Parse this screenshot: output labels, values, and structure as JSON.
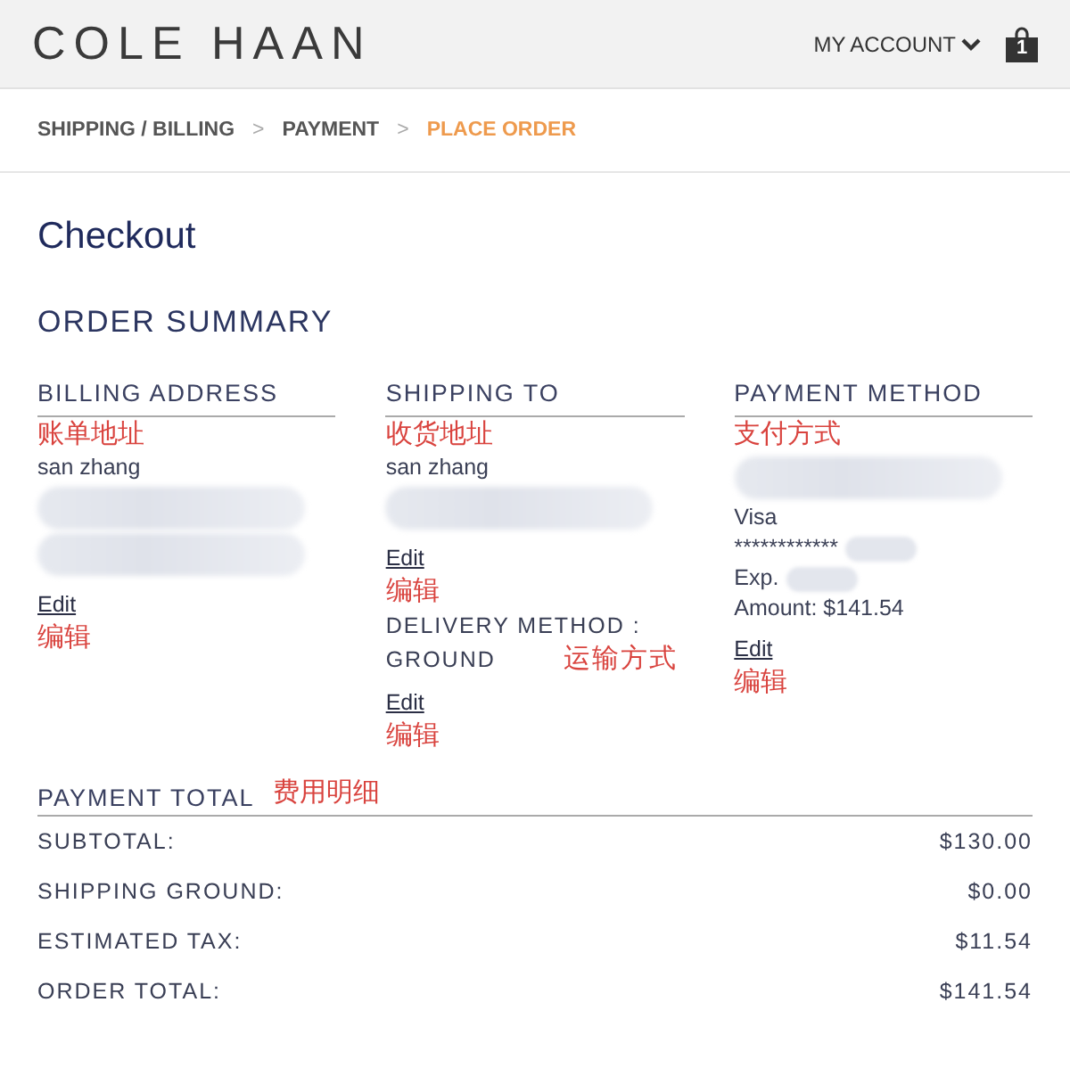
{
  "header": {
    "logo": "COLE HAAN",
    "account": "MY ACCOUNT",
    "cart_count": "1"
  },
  "breadcrumbs": [
    {
      "label": "SHIPPING / BILLING",
      "selected": false
    },
    {
      "label": "PAYMENT",
      "selected": false
    },
    {
      "label": "PLACE ORDER",
      "selected": true
    }
  ],
  "separator": ">",
  "title": "Checkout",
  "order_summary": {
    "heading": "ORDER SUMMARY",
    "columns": [
      {
        "heading": "BILLING ADDRESS",
        "items": [
          {
            "kind": "note",
            "text": "账单地址"
          },
          {
            "kind": "text",
            "text": "san zhang"
          },
          {
            "kind": "blur"
          },
          {
            "kind": "blur"
          },
          {
            "kind": "link",
            "text": "Edit"
          },
          {
            "kind": "note",
            "text": "编辑"
          }
        ]
      },
      {
        "heading": "SHIPPING TO",
        "items": [
          {
            "kind": "note",
            "text": "收货地址"
          },
          {
            "kind": "text",
            "text": "san zhang"
          },
          {
            "kind": "blur"
          },
          {
            "kind": "link",
            "text": "Edit"
          },
          {
            "kind": "note",
            "text": "编辑"
          },
          {
            "kind": "caps",
            "text": "DELIVERY METHOD :"
          },
          {
            "kind": "caps",
            "text": "GROUND",
            "note": "运输方式"
          },
          {
            "kind": "link",
            "text": "Edit"
          },
          {
            "kind": "note",
            "text": "编辑"
          }
        ]
      },
      {
        "heading": "PAYMENT METHOD",
        "items": [
          {
            "kind": "note",
            "text": "支付方式"
          },
          {
            "kind": "blur"
          },
          {
            "kind": "text",
            "text": "Visa"
          },
          {
            "kind": "text_blur",
            "text": "************"
          },
          {
            "kind": "text_blur",
            "text": "Exp."
          },
          {
            "kind": "text",
            "text": "Amount: $141.54"
          },
          {
            "kind": "link",
            "text": "Edit"
          },
          {
            "kind": "note",
            "text": "编辑"
          }
        ]
      }
    ]
  },
  "payment_total": {
    "heading": "PAYMENT TOTAL",
    "note": "费用明细",
    "rows": [
      {
        "label": "SUBTOTAL:",
        "value": "$130.00"
      },
      {
        "label": "SHIPPING GROUND:",
        "value": "$0.00"
      },
      {
        "label": "ESTIMATED TAX:",
        "value": "$11.54"
      },
      {
        "label": "ORDER TOTAL:",
        "value": "$141.54"
      }
    ]
  }
}
